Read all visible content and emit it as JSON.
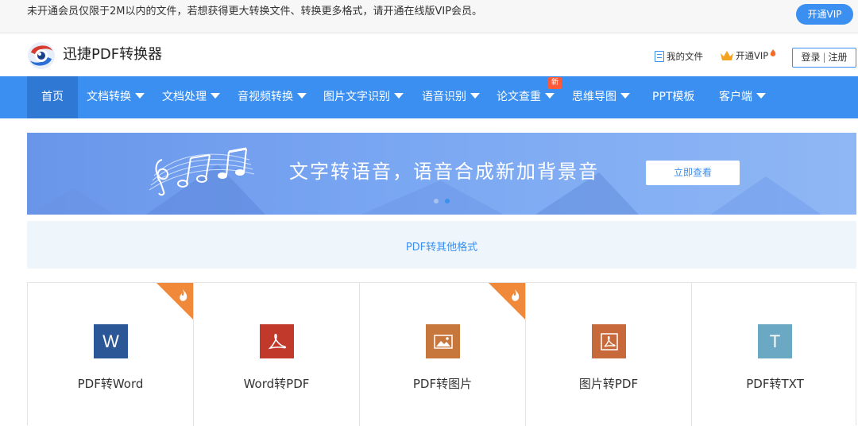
{
  "notice": {
    "text": "未开通会员仅限于2M以内的文件，若想获得更大转换文件、转换更多格式，请开通在线版VIP会员。",
    "button": "开通VIP"
  },
  "header": {
    "app_name": "迅捷PDF转换器",
    "my_files": "我的文件",
    "vip": "开通VIP",
    "login": "登录",
    "separator": "|",
    "register": "注册"
  },
  "nav": {
    "items": [
      {
        "label": "首页",
        "dropdown": false
      },
      {
        "label": "文档转换",
        "dropdown": true
      },
      {
        "label": "文档处理",
        "dropdown": true
      },
      {
        "label": "音视频转换",
        "dropdown": true
      },
      {
        "label": "图片文字识别",
        "dropdown": true
      },
      {
        "label": "语音识别",
        "dropdown": true
      },
      {
        "label": "论文查重",
        "dropdown": true
      },
      {
        "label": "思维导图",
        "dropdown": true
      },
      {
        "label": "PPT模板",
        "dropdown": false
      },
      {
        "label": "客户端",
        "dropdown": true
      }
    ],
    "new_badge": "新"
  },
  "banner": {
    "title": "文字转语音，语音合成新加背景音",
    "button": "立即查看",
    "active_slide": 2,
    "slide_count": 2
  },
  "category": {
    "label": "PDF转其他格式"
  },
  "tools": [
    {
      "label": "PDF转Word",
      "icon": "word-icon",
      "glyph": "W",
      "color": "#2b5797",
      "hot": true
    },
    {
      "label": "Word转PDF",
      "icon": "pdf-acrobat-icon",
      "color": "#c0392b",
      "hot": false
    },
    {
      "label": "PDF转图片",
      "icon": "image-icon",
      "color": "#c8773c",
      "hot": true
    },
    {
      "label": "图片转PDF",
      "icon": "pdf-framed-icon",
      "color": "#c8693c",
      "hot": false
    },
    {
      "label": "PDF转TXT",
      "icon": "text-icon",
      "glyph": "T",
      "color": "#6aa8c4",
      "hot": false
    }
  ],
  "colors": {
    "primary": "#3b8ff0",
    "nav_active": "#2f79d5",
    "hot_corner": "#f08a3a",
    "new_badge": "#ff5a3a"
  }
}
